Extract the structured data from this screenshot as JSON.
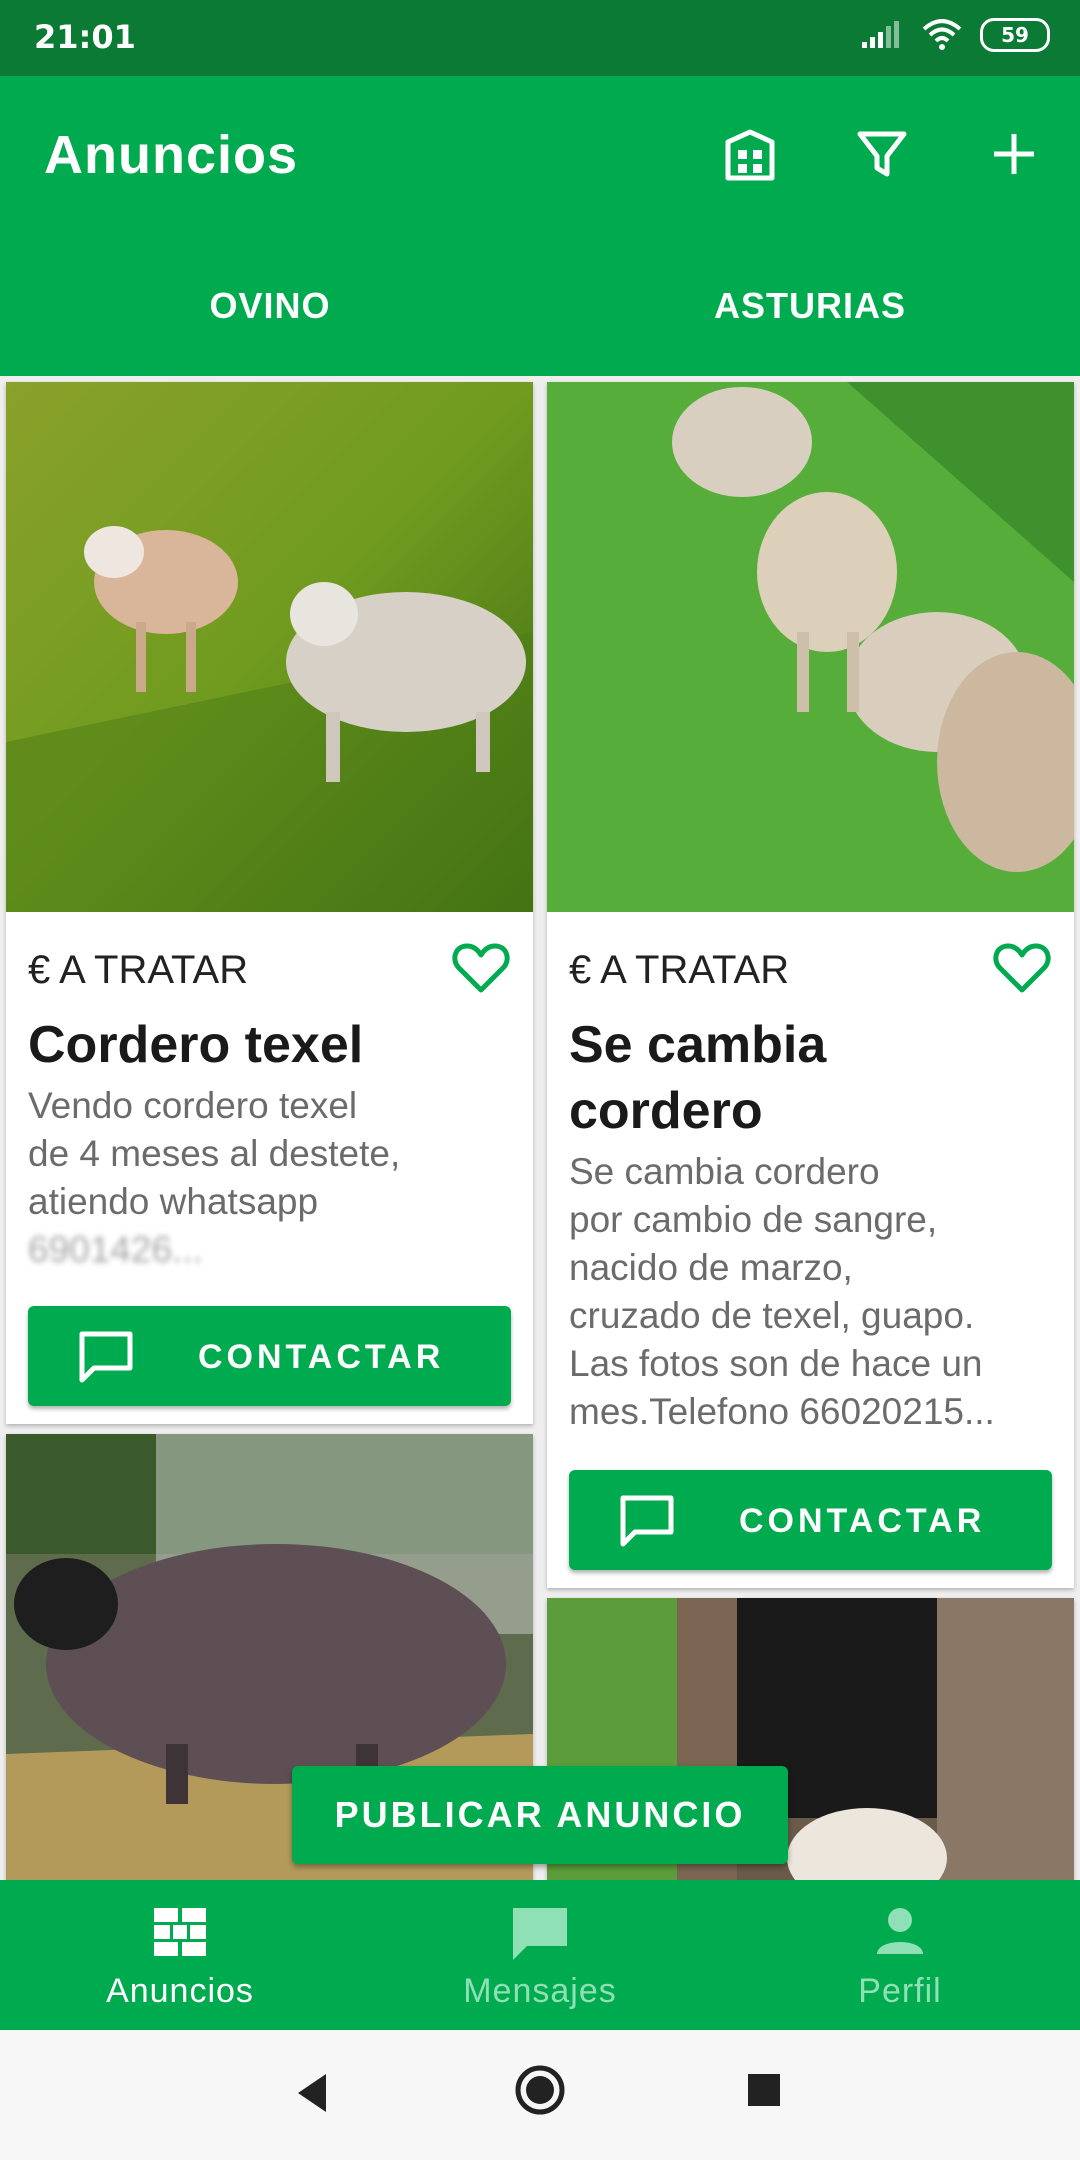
{
  "status_bar": {
    "time": "21:01",
    "battery": "59"
  },
  "app_bar": {
    "title": "Anuncios",
    "actions": [
      "building-icon",
      "filter-icon",
      "add-icon"
    ]
  },
  "tabs": [
    {
      "label": "OVINO"
    },
    {
      "label": "ASTURIAS"
    }
  ],
  "listings": [
    {
      "price": "€ A TRATAR",
      "title": "Cordero texel",
      "description_lines": [
        "Vendo cordero texel",
        "de 4 meses al destete,",
        "atiendo whatsapp",
        "6901426..."
      ],
      "button": "CONTACTAR"
    },
    {
      "price": "€ A TRATAR",
      "title_lines": [
        "Se cambia",
        "cordero"
      ],
      "description_lines": [
        "Se cambia cordero",
        "por cambio de sangre,",
        "nacido de marzo,",
        "cruzado de texel, guapo.",
        "Las fotos son de hace un",
        "mes.Telefono 66020215..."
      ],
      "button": "CONTACTAR"
    }
  ],
  "publish_button": "PUBLICAR ANUNCIO",
  "bottom_nav": [
    {
      "label": "Anuncios",
      "icon": "grid-icon",
      "active": true
    },
    {
      "label": "Mensajes",
      "icon": "chat-icon",
      "active": false
    },
    {
      "label": "Perfil",
      "icon": "person-icon",
      "active": false
    }
  ],
  "colors": {
    "primary": "#00aa4f",
    "status_bar": "#0a7a34",
    "inactive_nav": "#8fe0b5"
  }
}
